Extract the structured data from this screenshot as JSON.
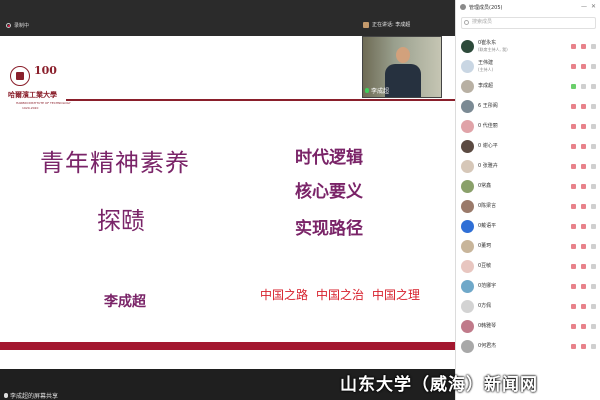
{
  "top": {
    "recording_label": "录制中",
    "speaking_label": "正在讲话: 李成超"
  },
  "slide": {
    "logo": {
      "name": "哈爾濱工業大學",
      "en": "HARBIN INSTITUTE OF TECHNOLOGY",
      "anniv": "100",
      "years": "1920-2020"
    },
    "title_line1": "青年精神素养",
    "title_line2": "探赜",
    "keywords": [
      "时代逻辑",
      "核心要义",
      "实现路径"
    ],
    "author": "李成超",
    "paths": [
      "中国之路",
      "中国之治",
      "中国之理"
    ]
  },
  "video": {
    "name": "李成超"
  },
  "bottom": {
    "sharer_label": "李成超的屏幕共享"
  },
  "panel": {
    "title": "管理成员(205)",
    "search_placeholder": "搜索成员",
    "members": [
      {
        "name": "0崔永东",
        "sub": "(联席主持人, 我)",
        "avatar": "#2d4a3a"
      },
      {
        "name": "王伟建",
        "sub": "(主持人)",
        "avatar": "#c9d6e3"
      },
      {
        "name": "李成超",
        "sub": "",
        "avatar": "#b8b0a3"
      },
      {
        "name": "6 王彤阁",
        "sub": "",
        "avatar": "#7b8a94"
      },
      {
        "name": "0 代佳丽",
        "sub": "",
        "avatar": "#e0a3a8"
      },
      {
        "name": "0 谢心平",
        "sub": "",
        "avatar": "#5b4a42"
      },
      {
        "name": "0 张雅卉",
        "sub": "",
        "avatar": "#d6c7b8"
      },
      {
        "name": "0常鑫",
        "sub": "",
        "avatar": "#8aa06a"
      },
      {
        "name": "0陈梁言",
        "sub": "",
        "avatar": "#9a7a6a"
      },
      {
        "name": "0戴语平",
        "sub": "",
        "avatar": "#2f6fd6"
      },
      {
        "name": "0董珂",
        "sub": "",
        "avatar": "#c8b59a"
      },
      {
        "name": "0豆敏",
        "sub": "",
        "avatar": "#e8c6c0"
      },
      {
        "name": "0范娜宇",
        "sub": "",
        "avatar": "#6fa8c9"
      },
      {
        "name": "0方佩",
        "sub": "",
        "avatar": "#d3d3d3"
      },
      {
        "name": "0韩雅琴",
        "sub": "",
        "avatar": "#c07a8a"
      },
      {
        "name": "0何君杰",
        "sub": "",
        "avatar": "#a8a8a8"
      }
    ]
  },
  "watermark": "山东大学（威海）新闻网"
}
